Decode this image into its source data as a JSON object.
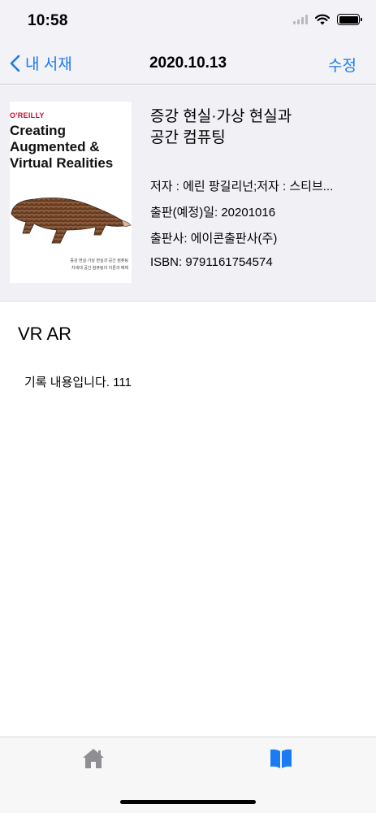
{
  "status_bar": {
    "time": "10:58"
  },
  "nav": {
    "back_label": "내 서재",
    "title": "2020.10.13",
    "edit_label": "수정"
  },
  "book": {
    "cover": {
      "publisher_logo": "O'REILLY",
      "title_line1": "Creating",
      "title_line2": "Augmented &",
      "title_line3": "Virtual Realities",
      "subtitle": "증강 현실·가상 현실과 공간 컴퓨팅",
      "tagline": "차세대 공간 컴퓨팅의 이론과 예제"
    },
    "title_line1": "증강 현실·가상 현실과",
    "title_line2": "공간 컴퓨팅",
    "author": "저자 : 에린 팡길리넌;저자 : 스티브...",
    "pub_date": "출판(예정)일: 20201016",
    "publisher": "출판사: 에이콘출판사(주)",
    "isbn": "ISBN: 9791161754574"
  },
  "record": {
    "title": "VR AR",
    "body": "기록 내용입니다. 111"
  },
  "tab_bar": {
    "items": [
      {
        "icon": "home-icon",
        "selected": false
      },
      {
        "icon": "book-icon",
        "selected": true
      }
    ],
    "colors": {
      "selected": "#1a7bf2",
      "unselected": "#8e8e93"
    }
  },
  "colors": {
    "accent": "#1a7bf2",
    "header_bg": "#f2f2f7",
    "book_bg": "#f0f0f5"
  }
}
